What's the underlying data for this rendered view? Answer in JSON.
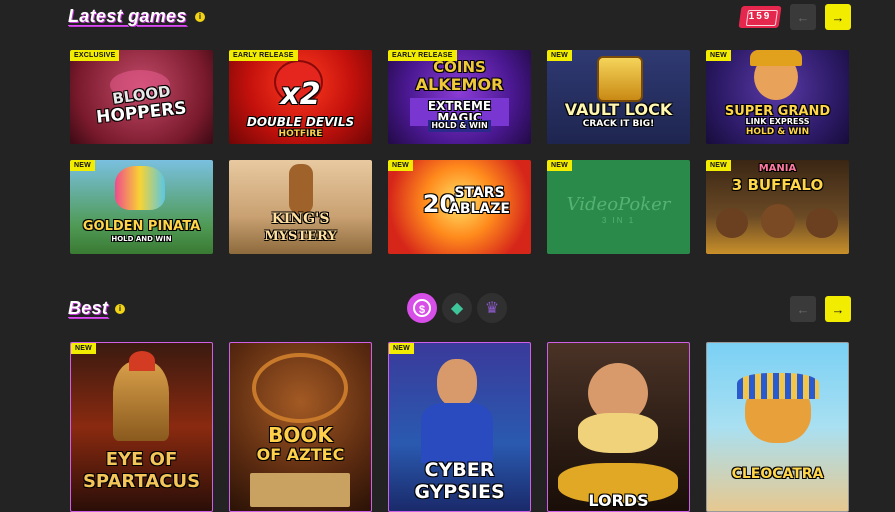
{
  "latest": {
    "title": "Latest games",
    "info": "i",
    "count": "159",
    "prev": "←",
    "next": "→",
    "games": [
      {
        "name": "Blood Hoppers",
        "line1": "BLOOD",
        "line2": "HOPPERS",
        "tag": "EXCLUSIVE"
      },
      {
        "name": "Double Devils Hotfire",
        "line1": "x2",
        "line2": "DOUBLE DEVILS",
        "line3": "HOTFIRE",
        "tag": "EARLY RELEASE"
      },
      {
        "name": "Coins of Alkemor Extreme Magic",
        "line1": "COINS",
        "line2": "ALKEMOR",
        "line3": "EXTREME MAGIC",
        "line4": "HOLD & WIN",
        "tag": "EARLY RELEASE"
      },
      {
        "name": "Vault Lock",
        "line1": "VAULT LOCK",
        "line2": "CRACK IT BIG!",
        "tag": "NEW"
      },
      {
        "name": "Super Grand Link Express Hold & Win",
        "line1": "SUPER GRAND",
        "line2": "LINK EXPRESS",
        "line3": "HOLD & WIN",
        "tag": "NEW"
      },
      {
        "name": "Golden Pinata",
        "line1": "GOLDEN PINATA",
        "line2": "HOLD AND WIN",
        "tag": "NEW"
      },
      {
        "name": "King's Mystery",
        "line1": "KING'S",
        "line2": "MYSTERY",
        "tag": ""
      },
      {
        "name": "20 Stars Ablaze",
        "line1": "20",
        "line2": "STARS",
        "line3": "ABLAZE",
        "tag": "NEW"
      },
      {
        "name": "Video Poker 3 in 1",
        "line1": "VideoPoker",
        "line2": "3 IN 1",
        "tag": "NEW"
      },
      {
        "name": "3 Buffalo Mania",
        "line1": "MANIA",
        "line2": "3 BUFFALO",
        "tag": "NEW"
      }
    ]
  },
  "best": {
    "title": "Best",
    "info": "i",
    "prev": "←",
    "next": "→",
    "categories": [
      {
        "icon": "dollar-coin-icon",
        "glyph": "$",
        "active": true
      },
      {
        "icon": "diamond-icon",
        "glyph": "◆",
        "active": false
      },
      {
        "icon": "crown-icon",
        "glyph": "♛",
        "active": false
      }
    ],
    "games": [
      {
        "name": "Eye of Spartacus",
        "line1": "EYE OF",
        "line2": "SPARTACUS",
        "tag": "NEW"
      },
      {
        "name": "Book of Aztec",
        "line1": "BOOK",
        "line2": "OF AZTEC",
        "tag": ""
      },
      {
        "name": "Cyber Gypsies",
        "line1": "CYBER",
        "line2": "GYPSIES",
        "tag": "NEW"
      },
      {
        "name": "Lords",
        "line1": "LORDS",
        "tag": ""
      },
      {
        "name": "Cleocatra",
        "line1": "CLEOCATRA",
        "tag": ""
      }
    ]
  }
}
